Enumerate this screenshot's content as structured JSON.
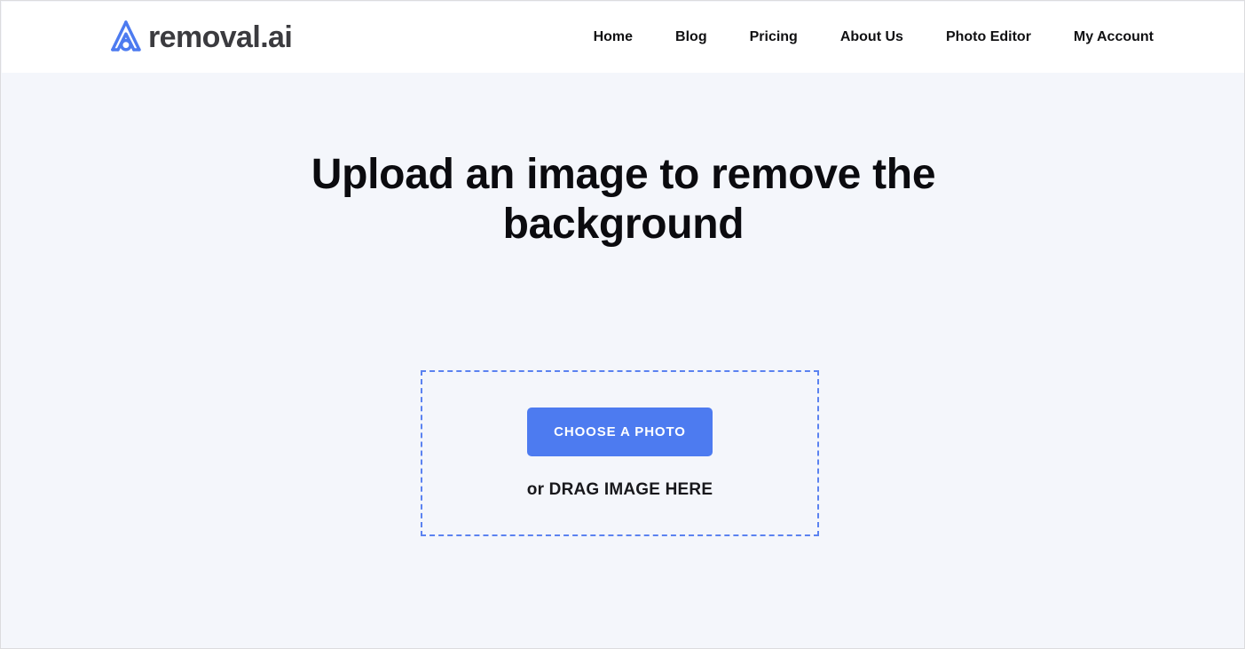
{
  "brand": {
    "logo_icon": "removal-ai-logo-icon",
    "wordmark": "removal.ai",
    "logo_color": "#4d7bf0",
    "wordmark_color": "#3b3b3f"
  },
  "nav": {
    "items": [
      {
        "label": "Home"
      },
      {
        "label": "Blog"
      },
      {
        "label": "Pricing"
      },
      {
        "label": "About Us"
      },
      {
        "label": "Photo Editor"
      },
      {
        "label": "My Account"
      }
    ]
  },
  "main": {
    "heading": "Upload an image to remove the background",
    "dropzone": {
      "button_label": "CHOOSE A PHOTO",
      "hint_prefix": "or ",
      "hint_text": "DRAG IMAGE HERE",
      "border_color": "#5b82f0",
      "button_color": "#4d7bf0"
    }
  },
  "theme": {
    "header_background": "#ffffff",
    "page_background": "#f4f6fb",
    "frame_border": "#dcdcde",
    "heading_color": "#0b0b0f",
    "nav_link_color": "#111113"
  }
}
